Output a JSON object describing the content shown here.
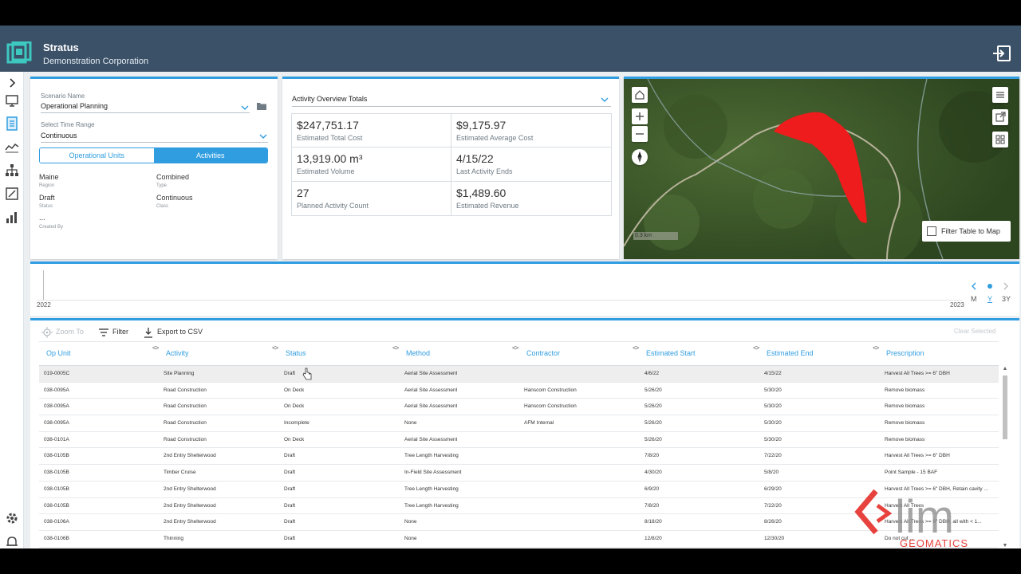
{
  "header": {
    "title": "Stratus",
    "org": "Demonstration Corporation"
  },
  "scenario": {
    "name_label": "Scenario Name",
    "name_value": "Operational Planning",
    "time_label": "Select Time Range",
    "time_value": "Continuous",
    "tabs": [
      "Operational Units",
      "Activities"
    ],
    "meta": [
      {
        "value": "Maine",
        "key": "Region"
      },
      {
        "value": "Combined",
        "key": "Type"
      },
      {
        "value": "Draft",
        "key": "Status"
      },
      {
        "value": "Continuous",
        "key": "Class"
      },
      {
        "value": "...",
        "key": "Created By"
      }
    ]
  },
  "totals": {
    "dropdown": "Activity Overview Totals",
    "cells": [
      {
        "value": "$247,751.17",
        "label": "Estimated Total Cost"
      },
      {
        "value": "$9,175.97",
        "label": "Estimated Average Cost"
      },
      {
        "value": "13,919.00 m³",
        "label": "Estimated Volume"
      },
      {
        "value": "4/15/22",
        "label": "Last Activity Ends"
      },
      {
        "value": "27",
        "label": "Planned Activity Count"
      },
      {
        "value": "$1,489.60",
        "label": "Estimated Revenue"
      }
    ]
  },
  "map": {
    "scale": "0.3 km",
    "filter_label": "Filter Table to Map"
  },
  "timeline": {
    "start": "2022",
    "end": "2023",
    "modes": [
      "M",
      "Y",
      "3Y"
    ]
  },
  "toolbar": {
    "zoom": "Zoom To",
    "filter": "Filter",
    "export": "Export to CSV",
    "clear": "Clear Selected"
  },
  "columns": [
    "Op Unit",
    "Activity",
    "Status",
    "Method",
    "Contractor",
    "Estimated Start",
    "Estimated End",
    "Prescription"
  ],
  "rows": [
    [
      "019-0005C",
      "Site Planning",
      "Draft",
      "Aerial Site Assessment",
      "",
      "4/6/22",
      "4/15/22",
      "Harvest All Trees >= 6\" DBH"
    ],
    [
      "038-0095A",
      "Road Construction",
      "On Deck",
      "Aerial Site Assessment",
      "Hanscom Construction",
      "5/26/20",
      "5/30/20",
      "Remove biomass"
    ],
    [
      "038-0095A",
      "Road Construction",
      "On Deck",
      "Aerial Site Assessment",
      "Hanscom Construction",
      "5/26/20",
      "5/30/20",
      "Remove biomass"
    ],
    [
      "038-0095A",
      "Road Construction",
      "Incomplete",
      "None",
      "AFM Internal",
      "5/26/20",
      "5/30/20",
      "Remove biomass"
    ],
    [
      "038-0101A",
      "Road Construction",
      "On Deck",
      "Aerial Site Assessment",
      "",
      "5/26/20",
      "5/30/20",
      "Remove biomass"
    ],
    [
      "038-0105B",
      "2nd Entry Shelterwood",
      "Draft",
      "Tree Length Harvesting",
      "",
      "7/8/20",
      "7/22/20",
      "Harvest All Trees >= 6\" DBH"
    ],
    [
      "038-0105B",
      "Timber Cruise",
      "Draft",
      "In-Field Site Assessment",
      "",
      "4/30/20",
      "5/8/20",
      "Point Sample - 15 BAF"
    ],
    [
      "038-0105B",
      "2nd Entry Shelterwood",
      "Draft",
      "Tree Length Harvesting",
      "",
      "6/9/20",
      "6/29/20",
      "Harvest All Trees >= 6\" DBH, Retain cavity ..."
    ],
    [
      "038-0105B",
      "2nd Entry Shelterwood",
      "Draft",
      "Tree Length Harvesting",
      "",
      "7/8/20",
      "7/22/20",
      "Harvest All Trees"
    ],
    [
      "038-0106A",
      "2nd Entry Shelterwood",
      "Draft",
      "None",
      "",
      "8/18/20",
      "8/26/20",
      "Harvest All Trees >= 6\" DBH, all with < 1..."
    ],
    [
      "038-0106B",
      "Thinning",
      "Draft",
      "None",
      "",
      "12/8/20",
      "12/30/20",
      "Do not cut ..."
    ]
  ],
  "watermark": {
    "logo_text": "lim",
    "sub_text": "GEOMATICS"
  },
  "colors": {
    "accent": "#2f9de0",
    "header": "#3b5168",
    "polygon": "#ee1c1c",
    "brand": "#e5322d"
  }
}
